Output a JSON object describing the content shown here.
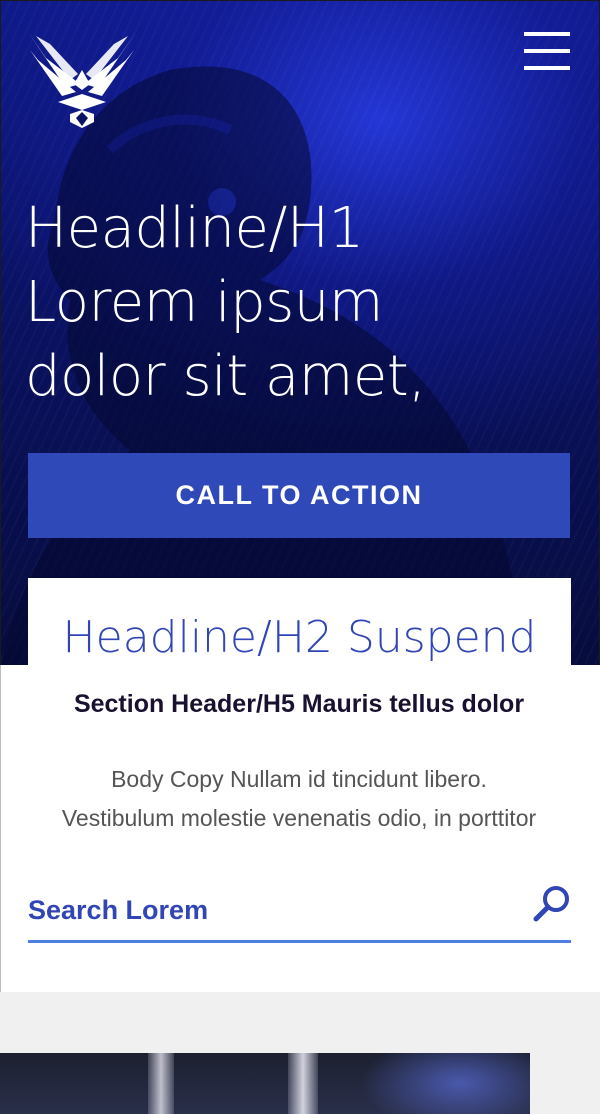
{
  "header": {
    "logo_icon": "air-force-wings-logo-icon",
    "menu_icon": "hamburger-menu-icon"
  },
  "hero": {
    "headline_lines": [
      "Headline/H1",
      "Lorem ipsum",
      "dolor sit amet,"
    ],
    "cta_label": "CALL TO ACTION"
  },
  "section": {
    "h2": "Headline/H2 Suspend",
    "h5": "Section Header/H5 Mauris tellus dolor",
    "body_lines": [
      "Body Copy Nullam id tincidunt libero.",
      "Vestibulum molestie venenatis odio, in porttitor"
    ],
    "search": {
      "placeholder": "Search Lorem",
      "icon": "search-icon"
    }
  },
  "colors": {
    "brand_blue": "#3245b5",
    "cta_blue": "#2f4ab8",
    "search_underline": "#4f7ee2",
    "hero_dark": "#0a1263",
    "page_bg": "#f0f0f0"
  }
}
